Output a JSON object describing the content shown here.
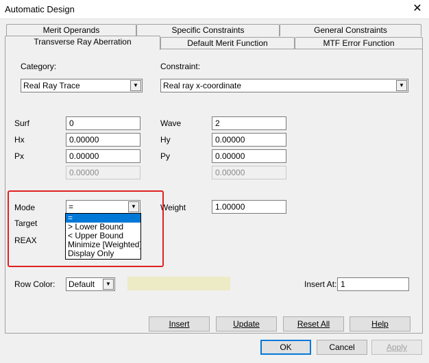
{
  "window": {
    "title": "Automatic Design",
    "close_glyph": "✕"
  },
  "tabs": {
    "row1": [
      "Merit Operands",
      "Specific Constraints",
      "General Constraints"
    ],
    "row2": [
      "Transverse Ray Aberration",
      "Default Merit Function",
      "MTF Error Function"
    ]
  },
  "category": {
    "label": "Category:",
    "value": "Real Ray Trace"
  },
  "constraint": {
    "label": "Constraint:",
    "value": "Real ray x-coordinate"
  },
  "fields": {
    "surf": {
      "label": "Surf",
      "value": "0"
    },
    "hx": {
      "label": "Hx",
      "value": "0.00000"
    },
    "px": {
      "label": "Px",
      "value": "0.00000"
    },
    "extra_left": {
      "value": "0.00000"
    },
    "wave": {
      "label": "Wave",
      "value": "2"
    },
    "hy": {
      "label": "Hy",
      "value": "0.00000"
    },
    "py": {
      "label": "Py",
      "value": "0.00000"
    },
    "extra_right": {
      "value": "0.00000"
    }
  },
  "mode": {
    "label": "Mode",
    "value": "=",
    "options": [
      "=",
      "> Lower Bound",
      "< Upper Bound",
      "Minimize [Weighted]",
      "Display Only"
    ],
    "selected_index": 0
  },
  "weight": {
    "label": "Weight",
    "value": "1.00000"
  },
  "target": {
    "label": "Target"
  },
  "operand": {
    "label": "REAX"
  },
  "row_color": {
    "label": "Row Color:",
    "value": "Default",
    "swatch_color": "#ecebc5"
  },
  "insert_at": {
    "label": "Insert At:",
    "value": "1"
  },
  "actions": {
    "insert": "Insert",
    "update": "Update",
    "reset_all": "Reset All",
    "help": "Help"
  },
  "dialog_buttons": {
    "ok": "OK",
    "cancel": "Cancel",
    "apply": "Apply"
  },
  "colors": {
    "highlight": "#e02020",
    "selection": "#0078d7"
  }
}
